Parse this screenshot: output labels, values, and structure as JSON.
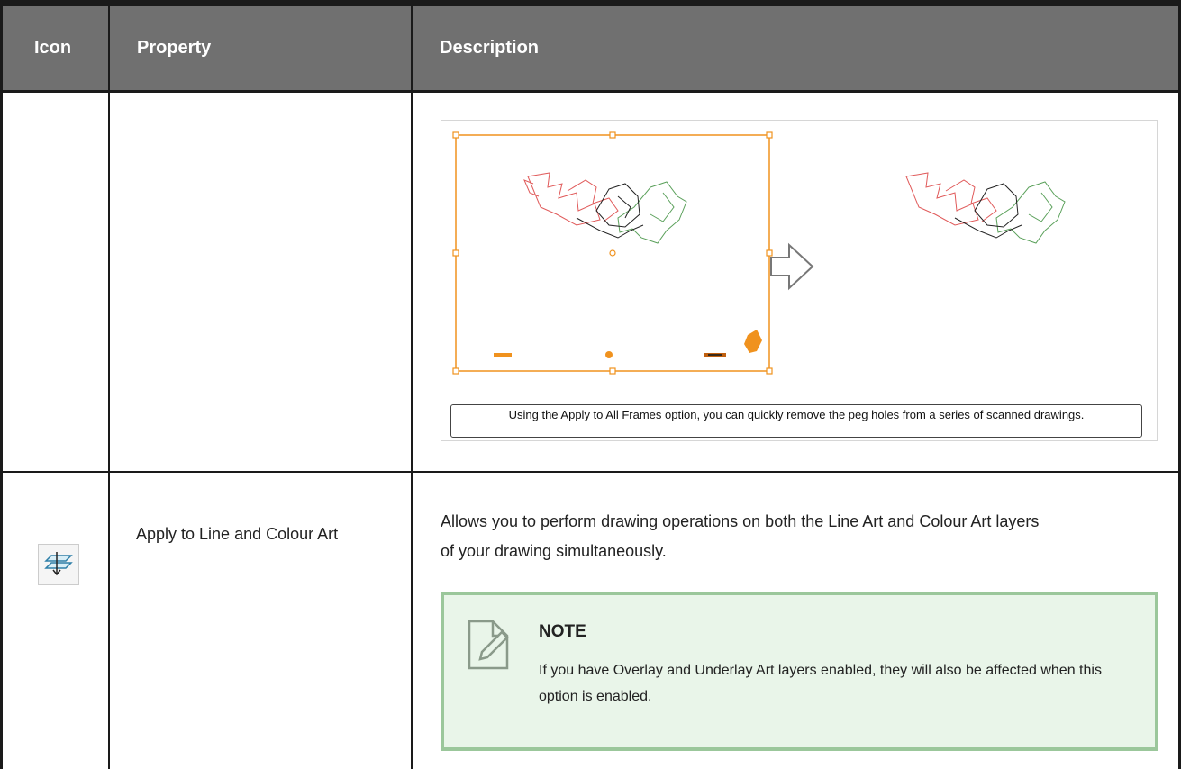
{
  "table": {
    "headers": [
      "Icon",
      "Property",
      "Description"
    ],
    "rows": [
      {
        "icon": "",
        "property": "",
        "figure": {
          "caption": "Using the Apply to All Frames option, you can quickly remove the peg holes from a series of scanned drawings."
        }
      },
      {
        "icon": "apply-to-line-and-colour-art-icon",
        "property": "Apply to Line and Colour Art",
        "description": "Allows you to perform drawing operations on both the Line Art and Colour Art layers of your drawing simultaneously.",
        "note": {
          "title": "NOTE",
          "body": "If you have Overlay and Underlay Art layers enabled, they will also be affected when this option is enabled."
        }
      }
    ]
  },
  "colors": {
    "header_bg": "#707070",
    "note_bg": "#e9f5e9",
    "note_border": "#9bc79b",
    "selection": "#f0921e"
  }
}
